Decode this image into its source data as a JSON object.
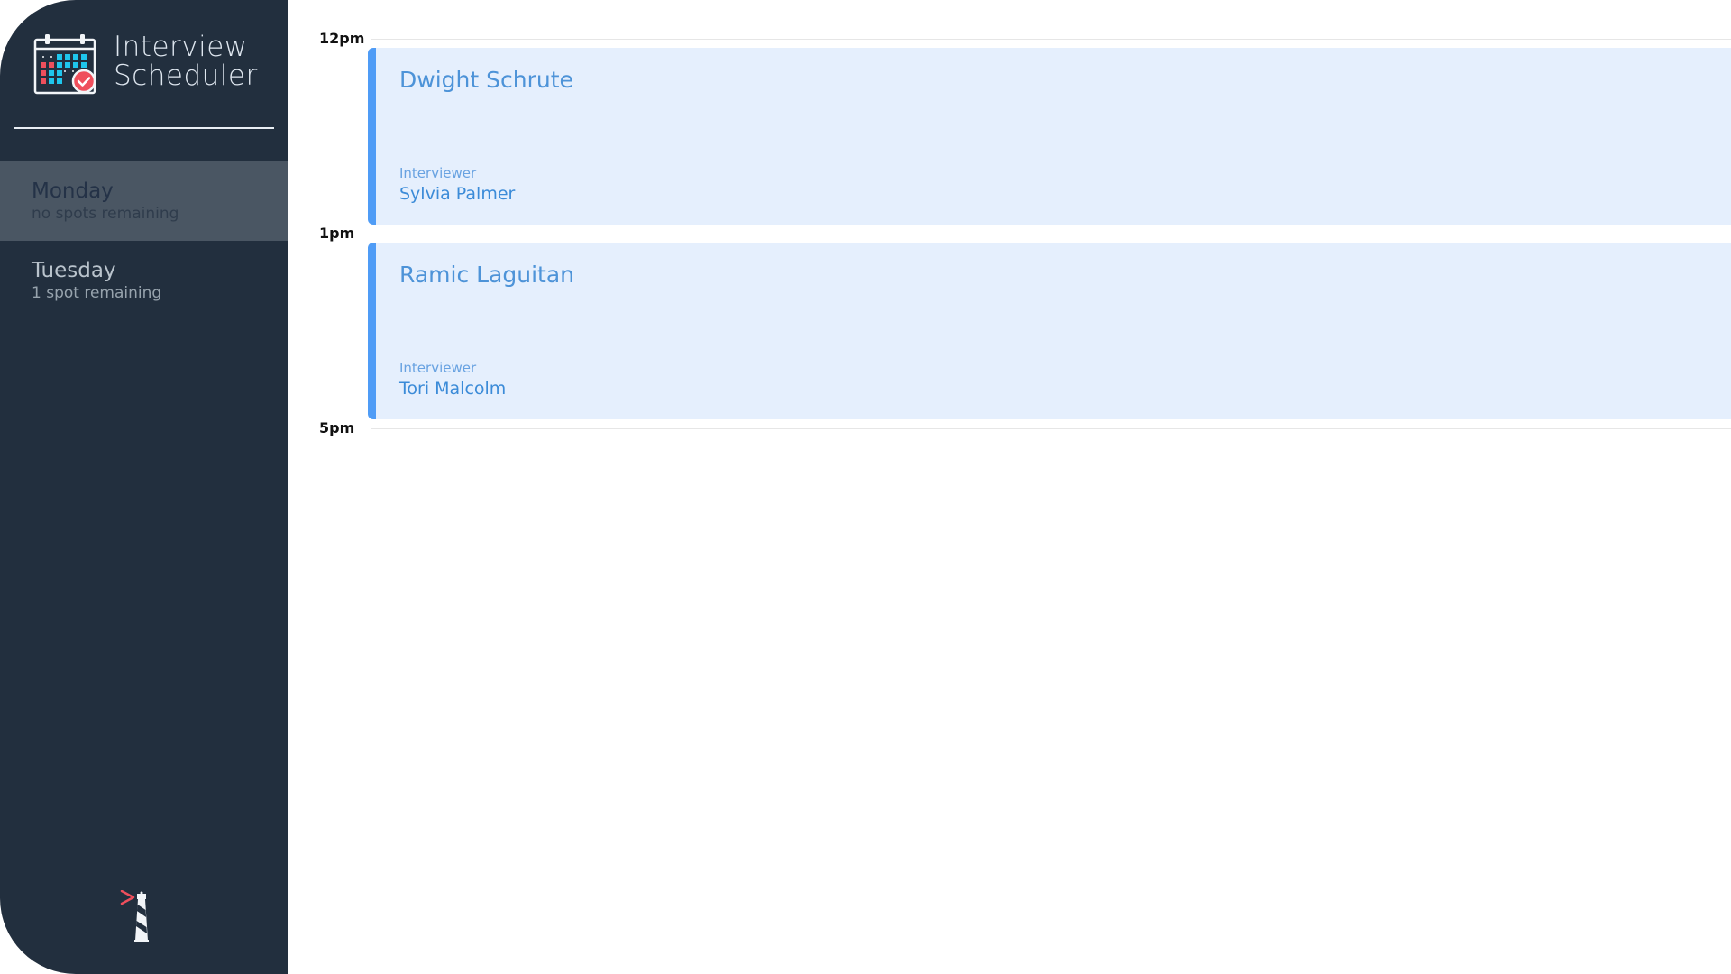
{
  "app": {
    "title_line1": "Interview",
    "title_line2": "Scheduler",
    "logo_icon": "calendar-check-icon",
    "footer_icon": "lighthouse-icon"
  },
  "days": [
    {
      "name": "Monday",
      "spots": "no spots remaining",
      "selected": true
    },
    {
      "name": "Tuesday",
      "spots": "1 spot remaining",
      "selected": false
    }
  ],
  "schedule": {
    "times": [
      "12pm",
      "1pm",
      "5pm"
    ],
    "appointments": [
      {
        "student": "Dwight Schrute",
        "interviewer_label": "Interviewer",
        "interviewer": "Sylvia Palmer"
      },
      {
        "student": "Ramic Laguitan",
        "interviewer_label": "Interviewer",
        "interviewer": "Tori Malcolm"
      }
    ]
  },
  "colors": {
    "sidebar_bg": "#222f3e",
    "selected_day_bg": "#4a5663",
    "appointment_bg": "#e5effd",
    "appointment_accent": "#4f9cf6",
    "appointment_text": "#4d93d8"
  }
}
